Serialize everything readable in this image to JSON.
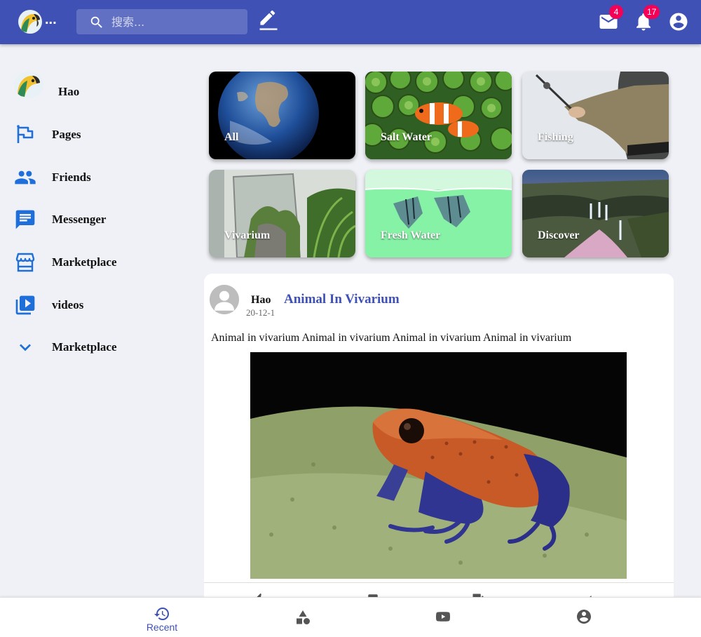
{
  "header": {
    "logo_ellipsis": "...",
    "search_placeholder": "搜索...",
    "mail_badge": "4",
    "notifications_badge": "17"
  },
  "sidebar": {
    "items": [
      {
        "label": "Hao",
        "icon": "parrot-avatar"
      },
      {
        "label": "Pages",
        "icon": "flag-icon"
      },
      {
        "label": "Friends",
        "icon": "people-icon"
      },
      {
        "label": "Messenger",
        "icon": "chat-icon"
      },
      {
        "label": "Marketplace",
        "icon": "store-icon"
      },
      {
        "label": "videos",
        "icon": "video-library-icon"
      },
      {
        "label": "Marketplace",
        "icon": "chevron-down-icon"
      }
    ]
  },
  "categories": [
    {
      "label": "All"
    },
    {
      "label": "Salt Water"
    },
    {
      "label": "Fishing"
    },
    {
      "label": "Vivarium"
    },
    {
      "label": "Fresh Water"
    },
    {
      "label": "Discover"
    }
  ],
  "post": {
    "author": "Hao",
    "date": "20-12-1",
    "title": "Animal In Vivarium",
    "text": "Animal in vivarium Animal in vivarium Animal in vivarium Animal in vivarium"
  },
  "bottom_nav": {
    "recent_label": "Recent"
  },
  "colors": {
    "primary": "#3f51b5",
    "badge": "#f50057",
    "sidebar_icon": "#1e6fd9",
    "background": "#f0f1f6"
  }
}
